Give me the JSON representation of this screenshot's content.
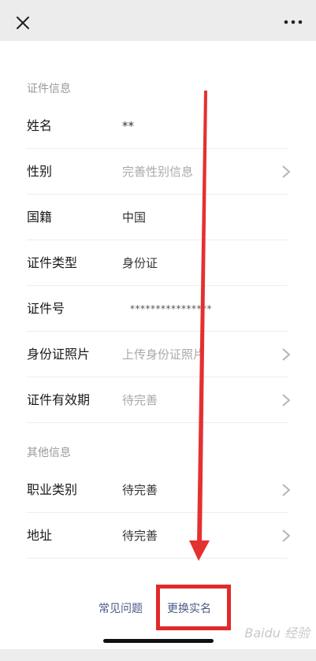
{
  "topbar": {
    "close_icon": "close-icon",
    "more_icon": "more-dots-icon"
  },
  "sections": {
    "certificate": "证件信息",
    "other": "其他信息"
  },
  "rows": [
    {
      "label": "姓名",
      "value": "**",
      "style": "filled",
      "chevron": false
    },
    {
      "label": "性别",
      "value": "完善性别信息",
      "style": "placeholder",
      "chevron": true
    },
    {
      "label": "国籍",
      "value": "中国",
      "style": "filled",
      "chevron": false
    },
    {
      "label": "证件类型",
      "value": "身份证",
      "style": "filled",
      "chevron": false
    },
    {
      "label": "证件号",
      "value": "****************",
      "style": "masked",
      "chevron": false
    },
    {
      "label": "身份证照片",
      "value": "上传身份证照片",
      "style": "placeholder",
      "chevron": true
    },
    {
      "label": "证件有效期",
      "value": "待完善",
      "style": "placeholder",
      "chevron": true
    },
    {
      "label": "职业类别",
      "value": "待完善",
      "style": "filled",
      "chevron": true
    },
    {
      "label": "地址",
      "value": "待完善",
      "style": "filled",
      "chevron": true
    }
  ],
  "footer": {
    "faq": "常见问题",
    "change_name": "更换实名"
  },
  "watermark": "Baidu 经验",
  "colors": {
    "highlight": "#e12a2a",
    "link": "#4a5a85"
  }
}
